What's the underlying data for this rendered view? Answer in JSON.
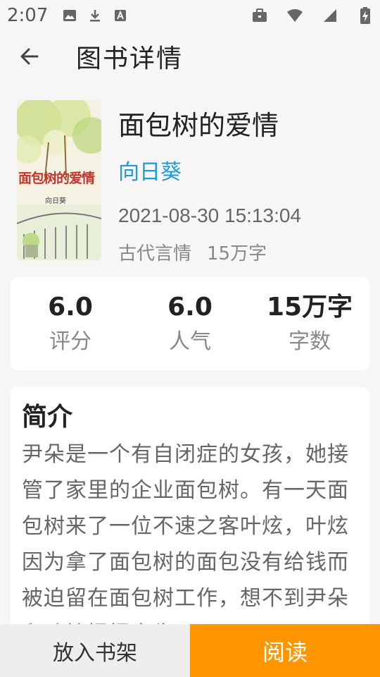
{
  "status_bar": {
    "time": "2:07",
    "icons": [
      "image-icon",
      "download-icon",
      "text-a-icon",
      "briefcase-icon",
      "wifi-icon",
      "signal-icon",
      "battery-charging-icon"
    ]
  },
  "app_bar": {
    "title": "图书详情",
    "back_icon": "arrow-left-icon"
  },
  "book": {
    "title": "面包树的爱情",
    "author": "向日葵",
    "date": "2021-08-30 15:13:04",
    "category": "古代言情",
    "word_count": "15万字",
    "cover": {
      "title_text": "面包树的爱情",
      "author_text": "向日葵"
    }
  },
  "stats": [
    {
      "value": "6.0",
      "label": "评分"
    },
    {
      "value": "6.0",
      "label": "人气"
    },
    {
      "value": "15万字",
      "label": "字数"
    }
  ],
  "intro": {
    "title": "简介",
    "text": "尹朵是一个有自闭症的女孩，她接管了家里的企业面包树。有一天面包树来了一位不速之客叶炫，叶炫因为拿了面包树的面包没有给钱而被迫留在面包树工作，想不到尹朵和叶炫慢慢产生"
  },
  "bottom_bar": {
    "shelf_label": "放入书架",
    "read_label": "阅读"
  },
  "colors": {
    "author": "#1e9bd7",
    "read_button": "#ff9500",
    "shelf_button": "#eeeeee",
    "background": "#f6f6f6"
  }
}
